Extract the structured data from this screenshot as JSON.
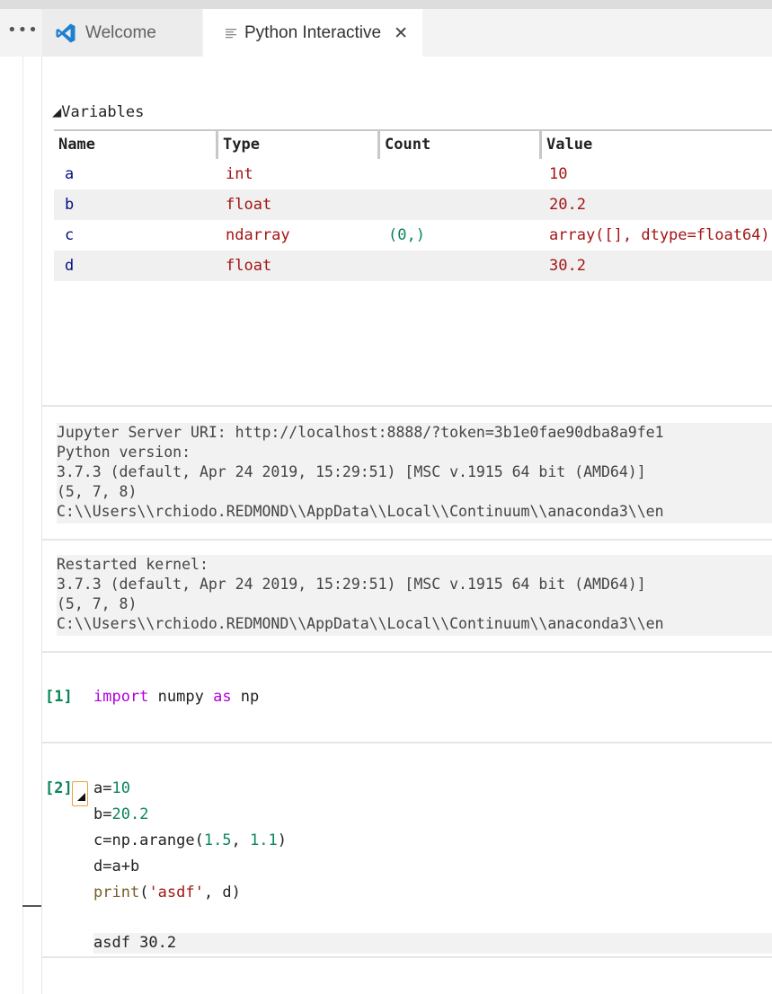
{
  "tabs": {
    "more_label": "•••",
    "welcome_label": "Welcome",
    "python_label": "Python Interactive",
    "close_label": "✕"
  },
  "variables": {
    "header": "◢Variables",
    "columns": [
      "Name",
      "Type",
      "Count",
      "Value"
    ],
    "rows": [
      {
        "name": "a",
        "type": "int",
        "count": "",
        "value": "10"
      },
      {
        "name": "b",
        "type": "float",
        "count": "",
        "value": "20.2"
      },
      {
        "name": "c",
        "type": "ndarray",
        "count": "(0,)",
        "value": "array([], dtype=float64)"
      },
      {
        "name": "d",
        "type": "float",
        "count": "",
        "value": "30.2"
      }
    ]
  },
  "info_blocks": [
    {
      "lines": [
        "Jupyter Server URI: http://localhost:8888/?token=3b1e0fae90dba8a9fe1",
        "Python version:",
        "3.7.3 (default, Apr 24 2019, 15:29:51) [MSC v.1915 64 bit (AMD64)]",
        "(5, 7, 8)",
        "C:\\\\Users\\\\rchiodo.REDMOND\\\\AppData\\\\Local\\\\Continuum\\\\anaconda3\\\\en"
      ]
    },
    {
      "lines": [
        "Restarted kernel:",
        "3.7.3 (default, Apr 24 2019, 15:29:51) [MSC v.1915 64 bit (AMD64)]",
        "(5, 7, 8)",
        "C:\\\\Users\\\\rchiodo.REDMOND\\\\AppData\\\\Local\\\\Continuum\\\\anaconda3\\\\en"
      ]
    }
  ],
  "cells": [
    {
      "number": "[1]",
      "code": {
        "kw1": "import",
        "mid": " numpy ",
        "kw2": "as",
        "end": " np"
      }
    },
    {
      "number": "[2]",
      "code_lines": {
        "l1_a": "a=",
        "l1_num": "10",
        "l2_a": "b=",
        "l2_num": "20.2",
        "l3_a": "c=np.arange(",
        "l3_n1": "1.5",
        "l3_b": ", ",
        "l3_n2": "1.1",
        "l3_c": ")",
        "l4": "d=a+b",
        "l5_fn": "print",
        "l5_a": "(",
        "l5_str": "'asdf'",
        "l5_b": ", d)"
      },
      "output": "asdf 30.2"
    }
  ],
  "colors": {
    "keyword": "#af00db",
    "number": "#098658",
    "string": "#a31515",
    "function": "#795e26",
    "accent_collapse": "#e8a33a"
  },
  "icons": [
    "more-icon",
    "vscode-icon",
    "preview-icon",
    "close-icon",
    "collapse-icon"
  ]
}
